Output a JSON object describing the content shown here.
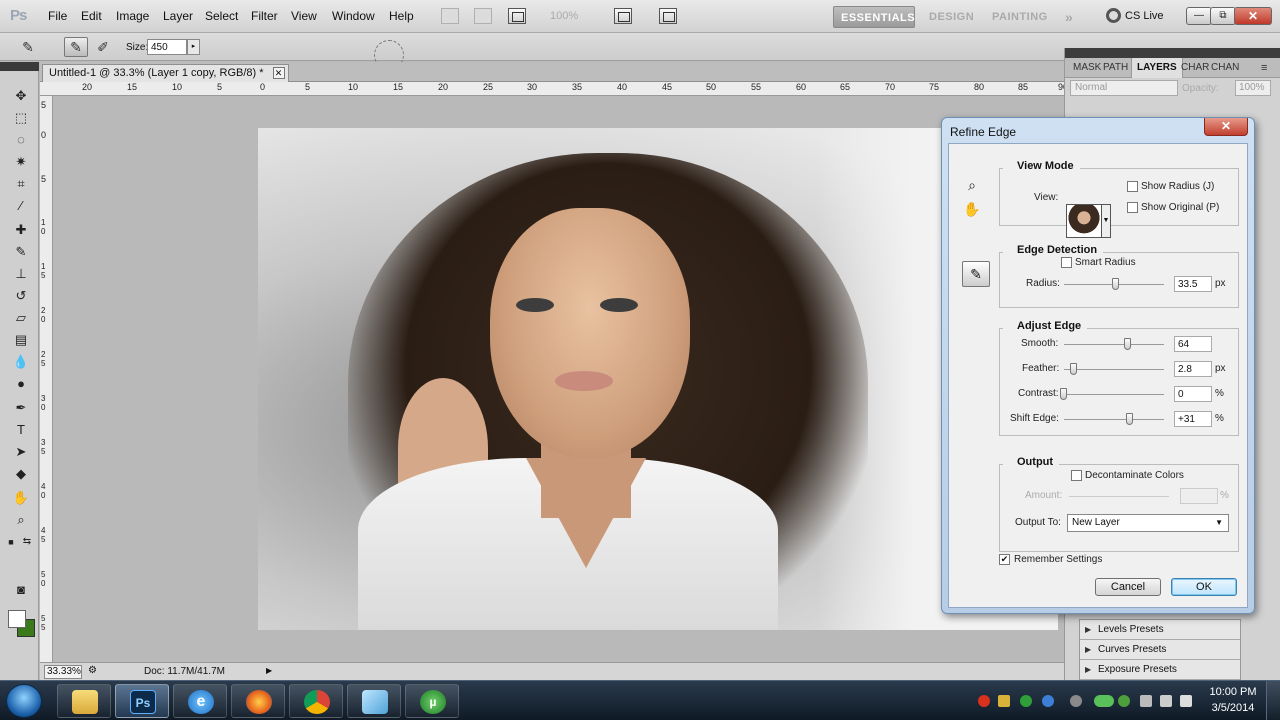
{
  "app": {
    "logo": "Ps",
    "menu": [
      "File",
      "Edit",
      "Image",
      "Layer",
      "Select",
      "Filter",
      "View",
      "Window",
      "Help"
    ],
    "zoom_display": "100%",
    "workspaces": [
      "ESSENTIALS",
      "DESIGN",
      "PAINTING"
    ],
    "more_workspaces": "»",
    "cs_live": "CS Live",
    "window_controls": {
      "minimize": "—",
      "restore": "⧉",
      "close": "✕"
    }
  },
  "options_bar": {
    "size_label": "Size:",
    "size_value": "450",
    "size_arrow": "▸"
  },
  "document": {
    "tab_title": "Untitled-1 @ 33.3% (Layer 1 copy, RGB/8) *",
    "tab_close": "✕",
    "ruler_top_labels": [
      "20",
      "15",
      "10",
      "5",
      "0",
      "5",
      "10",
      "15",
      "20",
      "25",
      "30",
      "35",
      "40",
      "45",
      "50",
      "55",
      "60",
      "65",
      "70",
      "75",
      "80",
      "85",
      "90"
    ],
    "ruler_left_labels": [
      "5",
      "0",
      "5",
      "1 0",
      "1 5",
      "2 0",
      "2 5",
      "3 0",
      "3 5",
      "4 0",
      "4 5",
      "5 0",
      "5 5",
      "6 0",
      "6 5"
    ],
    "status_zoom": "33.33%",
    "status_doc": "Doc: 11.7M/41.7M",
    "status_arrow": "▶"
  },
  "panels": {
    "tabs": [
      "MASK",
      "PATH",
      "LAYERS",
      "CHAR",
      "CHAN"
    ],
    "blend_mode": "Normal",
    "opacity_label": "Opacity:",
    "opacity_value": "100%",
    "adjustment_presets": [
      "Levels Presets",
      "Curves Presets",
      "Exposure Presets"
    ]
  },
  "refine_edge": {
    "title": "Refine Edge",
    "close": "✕",
    "view_mode": {
      "title": "View Mode",
      "view_label": "View:",
      "show_radius": "Show Radius (J)",
      "show_radius_checked": false,
      "show_original": "Show Original (P)",
      "show_original_checked": false
    },
    "edge_detection": {
      "title": "Edge Detection",
      "smart_radius": "Smart Radius",
      "smart_radius_checked": false,
      "radius_label": "Radius:",
      "radius_value": "33.5",
      "radius_unit": "px",
      "radius_fraction": 0.52
    },
    "adjust_edge": {
      "title": "Adjust Edge",
      "smooth_label": "Smooth:",
      "smooth_value": "64",
      "smooth_fraction": 0.64,
      "feather_label": "Feather:",
      "feather_value": "2.8",
      "feather_unit": "px",
      "feather_fraction": 0.1,
      "contrast_label": "Contrast:",
      "contrast_value": "0",
      "contrast_unit": "%",
      "contrast_fraction": 0.0,
      "shift_label": "Shift Edge:",
      "shift_value": "+31",
      "shift_unit": "%",
      "shift_fraction": 0.655
    },
    "output": {
      "title": "Output",
      "decontaminate": "Decontaminate Colors",
      "decontaminate_checked": false,
      "amount_label": "Amount:",
      "amount_unit": "%",
      "output_to_label": "Output To:",
      "output_to_value": "New Layer"
    },
    "remember_settings": "Remember Settings",
    "remember_checked": true,
    "cancel": "Cancel",
    "ok": "OK"
  },
  "taskbar": {
    "apps": [
      "explorer",
      "photoshop",
      "internet-explorer",
      "firefox",
      "chrome",
      "notepad",
      "utorrent"
    ],
    "ps_label": "Ps",
    "time": "10:00 PM",
    "date": "3/5/2014"
  },
  "colors": {
    "foreground": "#ffffff",
    "background": "#3b7a1a"
  }
}
